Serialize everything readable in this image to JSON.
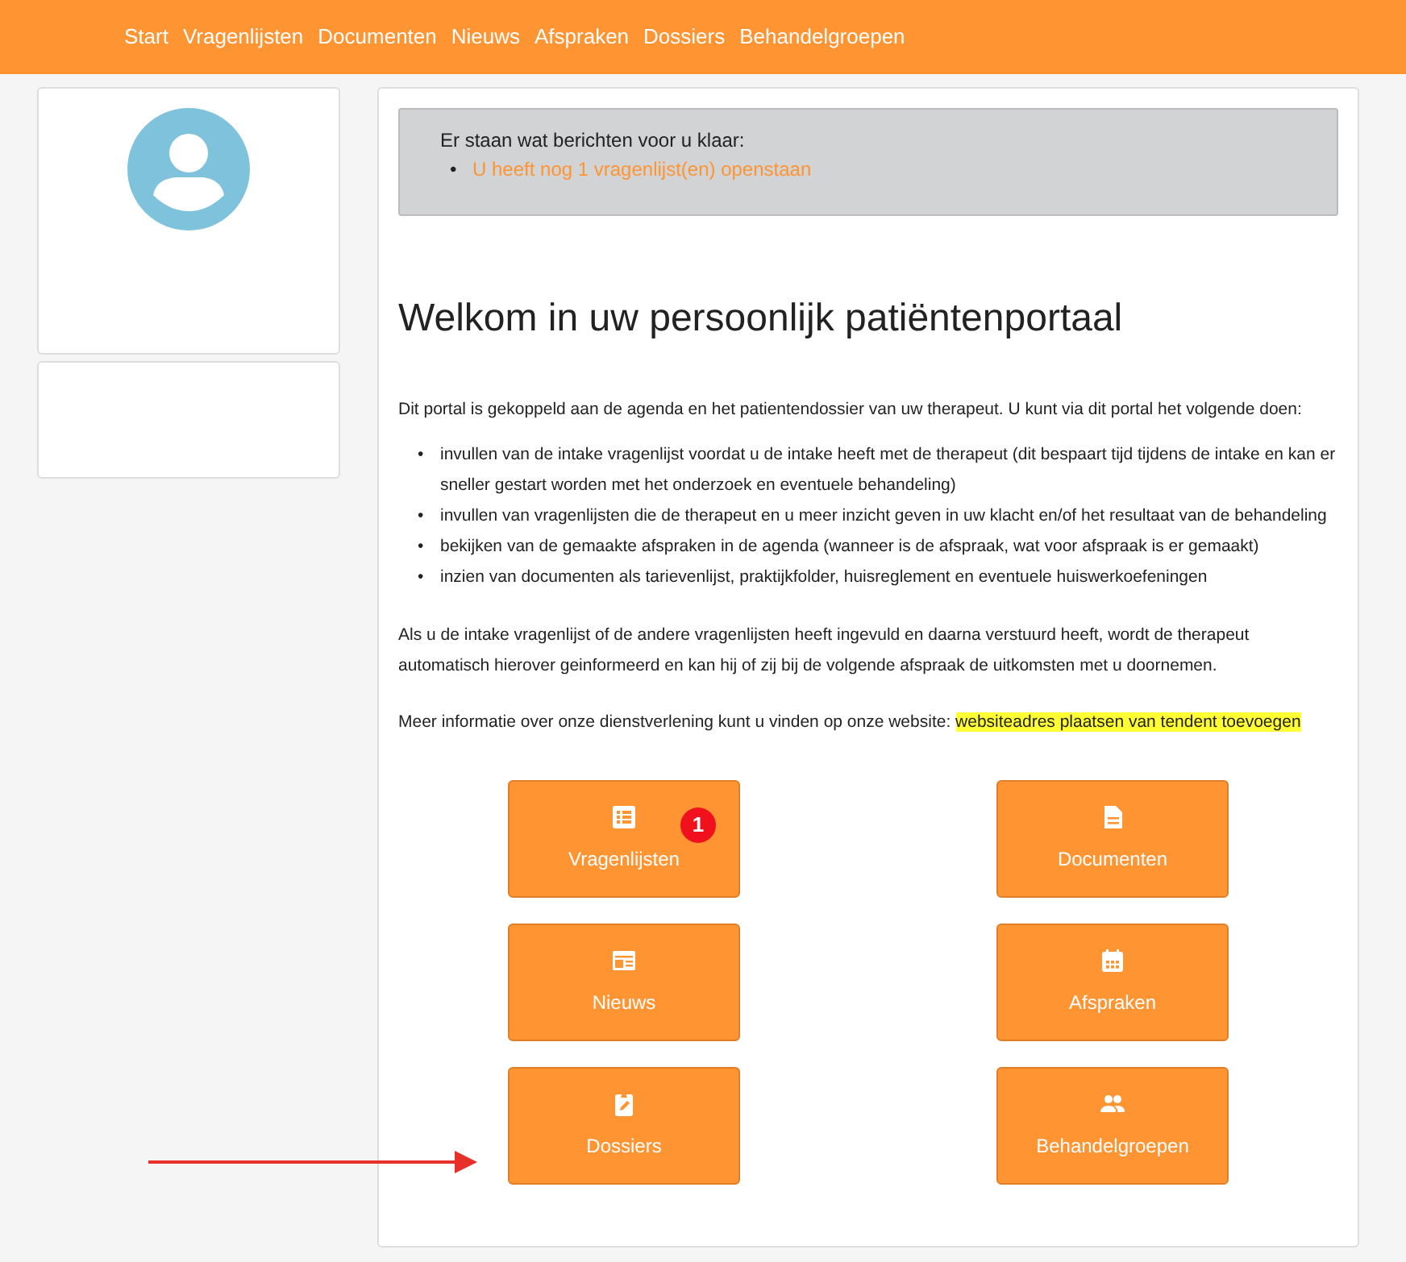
{
  "nav": {
    "items": [
      {
        "label": "Start"
      },
      {
        "label": "Vragenlijsten"
      },
      {
        "label": "Documenten"
      },
      {
        "label": "Nieuws"
      },
      {
        "label": "Afspraken"
      },
      {
        "label": "Dossiers"
      },
      {
        "label": "Behandelgroepen"
      }
    ]
  },
  "messages": {
    "title": "Er staan wat berichten voor u klaar:",
    "bullet": "•",
    "items": [
      "U heeft nog 1 vragenlijst(en) openstaan"
    ]
  },
  "heading": "Welkom in uw persoonlijk patiëntenportaal",
  "intro": "Dit portal is gekoppeld aan de agenda en het patientendossier van uw therapeut. U kunt via dit portal het volgende doen:",
  "bullet": "•",
  "bullets": [
    "invullen van de intake vragenlijst voordat u de intake heeft met de therapeut (dit bespaart tijd tijdens de intake en kan er sneller gestart worden met het onderzoek en eventuele behandeling)",
    "invullen van vragenlijsten die de therapeut en u meer inzicht geven in uw klacht en/of het resultaat van de behandeling",
    "bekijken van de gemaakte afspraken in de agenda (wanneer is de afspraak, wat voor afspraak is er gemaakt)",
    "inzien van documenten als tarievenlijst, praktijkfolder, huisreglement en eventuele huiswerkoefeningen"
  ],
  "paragraph": "Als u de intake vragenlijst of de andere vragenlijsten heeft ingevuld en daarna verstuurd heeft, wordt de therapeut automatisch hierover geinformeerd en kan hij of zij bij de volgende afspraak de uitkomsten met u doornemen.",
  "info": {
    "text": "Meer informatie over onze dienstverlening kunt u vinden op onze website:",
    "highlight": "websiteadres plaatsen van tendent toevoegen"
  },
  "tiles": [
    {
      "label": "Vragenlijsten",
      "kind": "list",
      "badge": "1"
    },
    {
      "label": "Documenten",
      "kind": "document"
    },
    {
      "label": "Nieuws",
      "kind": "news"
    },
    {
      "label": "Afspraken",
      "kind": "calendar"
    },
    {
      "label": "Dossiers",
      "kind": "clipboard"
    },
    {
      "label": "Behandelgroepen",
      "kind": "group"
    }
  ]
}
